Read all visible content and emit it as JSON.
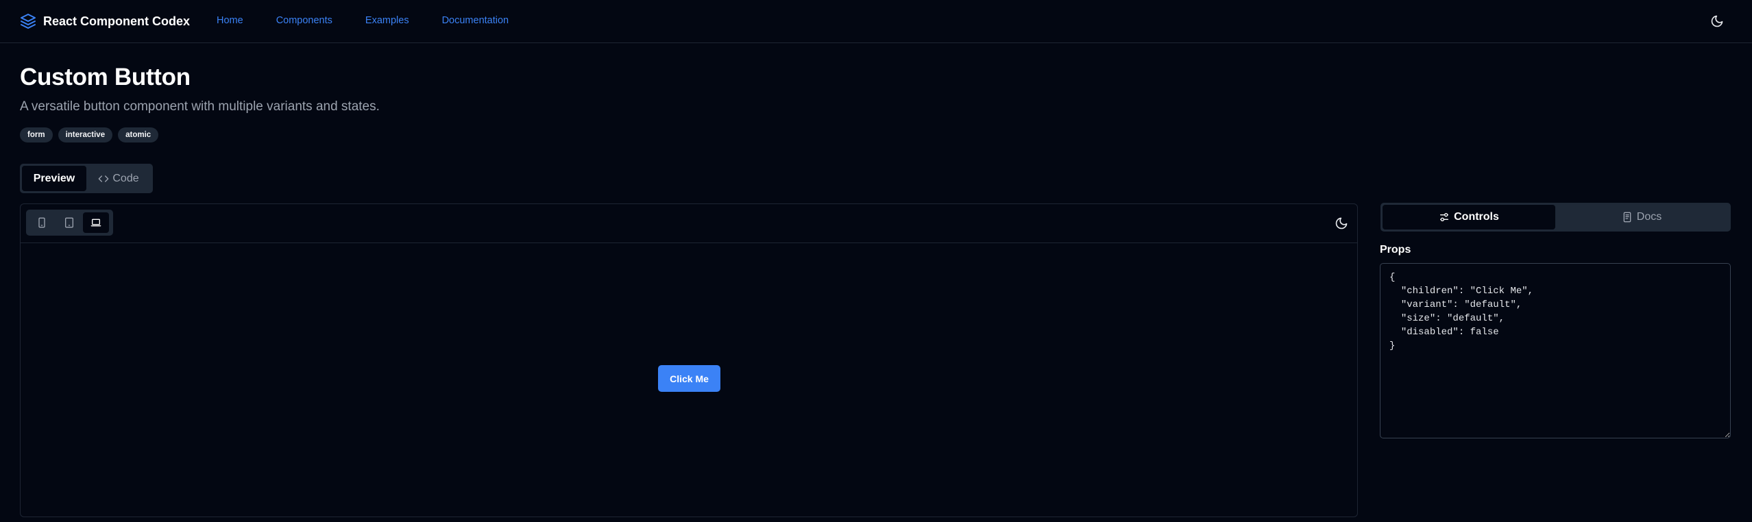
{
  "header": {
    "brand_title": "React Component Codex",
    "nav": [
      "Home",
      "Components",
      "Examples",
      "Documentation"
    ],
    "theme_icon": "moon-icon",
    "accent_color": "#3b82f6"
  },
  "page": {
    "title": "Custom Button",
    "description": "A versatile button component with multiple variants and states.",
    "tags": [
      "form",
      "interactive",
      "atomic"
    ]
  },
  "view_tabs": {
    "preview_label": "Preview",
    "code_label": "Code",
    "active": "Preview"
  },
  "preview": {
    "devices": [
      "mobile-icon",
      "tablet-icon",
      "laptop-icon"
    ],
    "active_device": "laptop",
    "demo_button_label": "Click Me"
  },
  "side_panel": {
    "controls_label": "Controls",
    "docs_label": "Docs",
    "active": "Controls",
    "props_heading": "Props",
    "props_value": "{\n  \"children\": \"Click Me\",\n  \"variant\": \"default\",\n  \"size\": \"default\",\n  \"disabled\": false\n}"
  }
}
